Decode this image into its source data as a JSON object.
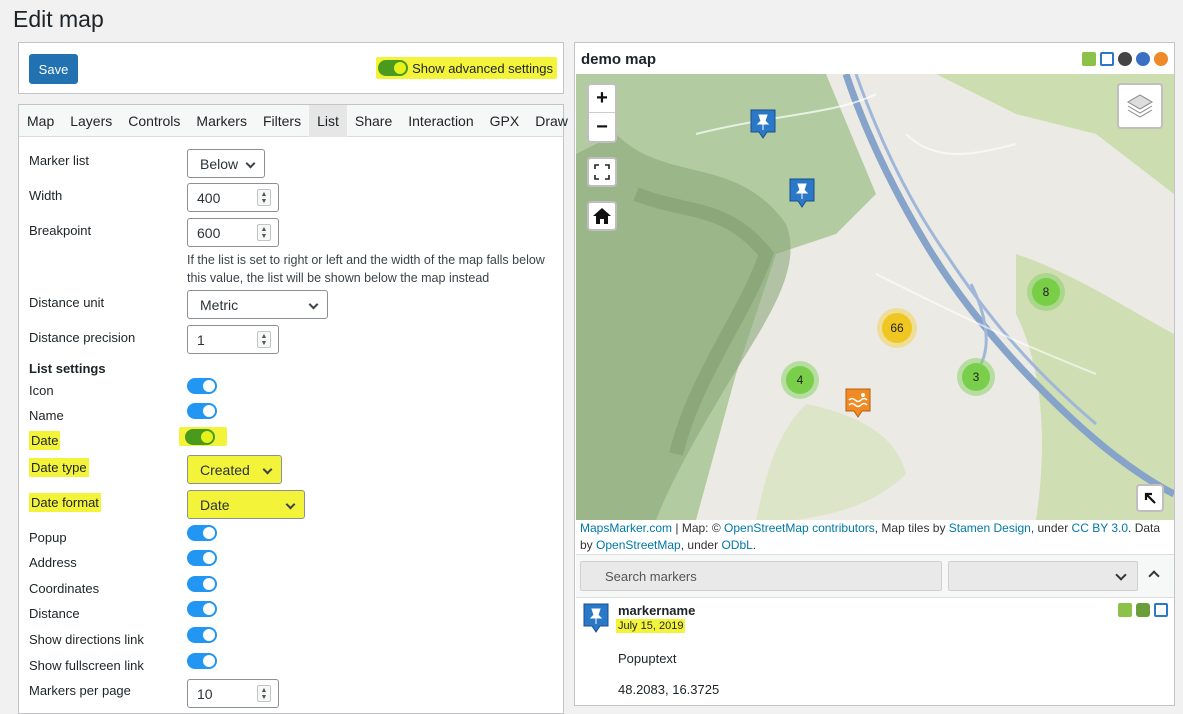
{
  "page": {
    "title": "Edit map"
  },
  "toolbar": {
    "save_label": "Save",
    "advanced_label": "Show advanced settings"
  },
  "tabs": [
    "Map",
    "Layers",
    "Controls",
    "Markers",
    "Filters",
    "List",
    "Share",
    "Interaction",
    "GPX",
    "Draw"
  ],
  "active_tab": "List",
  "fields": {
    "marker_list": {
      "label": "Marker list",
      "value": "Below"
    },
    "width": {
      "label": "Width",
      "value": "400"
    },
    "breakpoint": {
      "label": "Breakpoint",
      "value": "600",
      "help": "If the list is set to right or left and the width of the map falls below this value, the list will be shown below the map instead"
    },
    "distance_unit": {
      "label": "Distance unit",
      "value": "Metric"
    },
    "distance_precision": {
      "label": "Distance precision",
      "value": "1"
    }
  },
  "list_settings": {
    "title": "List settings",
    "icon": "Icon",
    "name": "Name",
    "date": "Date",
    "date_type": {
      "label": "Date type",
      "value": "Created"
    },
    "date_format": {
      "label": "Date format",
      "value": "Date"
    },
    "popup": "Popup",
    "address": "Address",
    "coordinates": "Coordinates",
    "distance": "Distance",
    "directions": "Show directions link",
    "fullscreen": "Show fullscreen link",
    "per_page": {
      "label": "Markers per page",
      "value": "10"
    }
  },
  "map": {
    "title": "demo map",
    "clusters": [
      "8",
      "66",
      "3",
      "4"
    ],
    "attribution": {
      "p1": "MapsMarker.com",
      "p2": " | Map: © ",
      "p3": "OpenStreetMap contributors",
      "p4": ", Map tiles by ",
      "p5": "Stamen Design",
      "p6": ", under ",
      "p7": "CC BY 3.0",
      "p8": ". Data by ",
      "p9": "OpenStreetMap",
      "p10": ", under ",
      "p11": "ODbL",
      "p12": "."
    },
    "search_placeholder": "Search markers",
    "marker": {
      "name": "markername",
      "date": "July 15, 2019",
      "popup": "Popuptext",
      "coords": "48.2083, 16.3725"
    }
  },
  "colors": {
    "accent": "#2271b1",
    "toggle_on": "#2196f3",
    "highlight": "#f3f33a"
  }
}
